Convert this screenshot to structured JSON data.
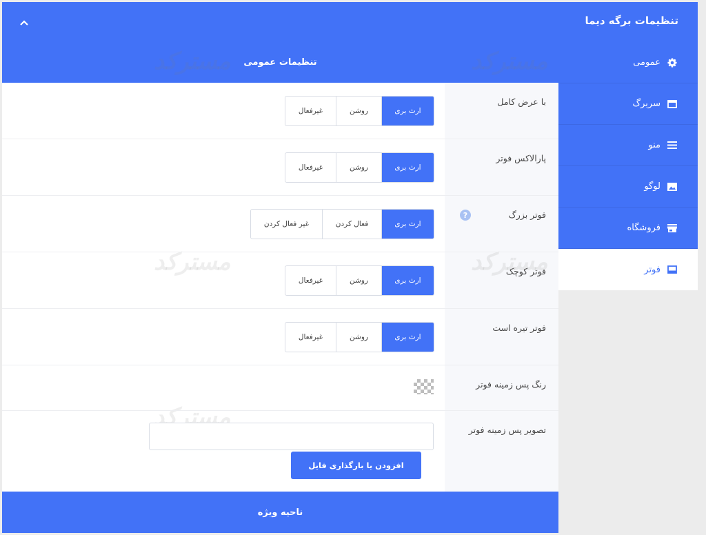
{
  "header": {
    "title": "تنظیمات برگه دیما"
  },
  "sidebar": {
    "items": [
      {
        "label": "عمومی",
        "icon": "gear-icon",
        "active": false
      },
      {
        "label": "سربرگ",
        "icon": "window-icon",
        "active": false
      },
      {
        "label": "منو",
        "icon": "menu-icon",
        "active": false
      },
      {
        "label": "لوگو",
        "icon": "image-icon",
        "active": false
      },
      {
        "label": "فروشگاه",
        "icon": "store-icon",
        "active": false
      },
      {
        "label": "فوتر",
        "icon": "footer-icon",
        "active": true
      }
    ]
  },
  "panel": {
    "title": "تنظیمات عمومی",
    "rows": [
      {
        "label": "با عرض کامل",
        "options": [
          "ارث بری",
          "روشن",
          "غیرفعال"
        ],
        "selected": "ارث بری"
      },
      {
        "label": "پارالاکس فوتر",
        "options": [
          "ارث بری",
          "روشن",
          "غیرفعال"
        ],
        "selected": "ارث بری"
      },
      {
        "label": "فوتر بزرگ",
        "help": "?",
        "options": [
          "ارث بری",
          "فعال کردن",
          "غیر فعال کردن"
        ],
        "selected": "ارث بری"
      },
      {
        "label": "فوتر کوچک",
        "options": [
          "ارث بری",
          "روشن",
          "غیرفعال"
        ],
        "selected": "ارث بری"
      },
      {
        "label": "فوتر تیره است",
        "options": [
          "ارث بری",
          "روشن",
          "غیرفعال"
        ],
        "selected": "ارث بری"
      }
    ],
    "bg_color": {
      "label": "رنگ پس زمینه فوتر"
    },
    "bg_image": {
      "label": "تصویر پس زمینه فوتر",
      "value": "",
      "upload_label": "افزودن یا بارگذاری فایل"
    },
    "footer_section": "ناحیه ویژه"
  },
  "watermark": "مسترکد",
  "colors": {
    "accent": "#4272f7",
    "background": "#ececec",
    "panel": "#f7f8fb"
  }
}
